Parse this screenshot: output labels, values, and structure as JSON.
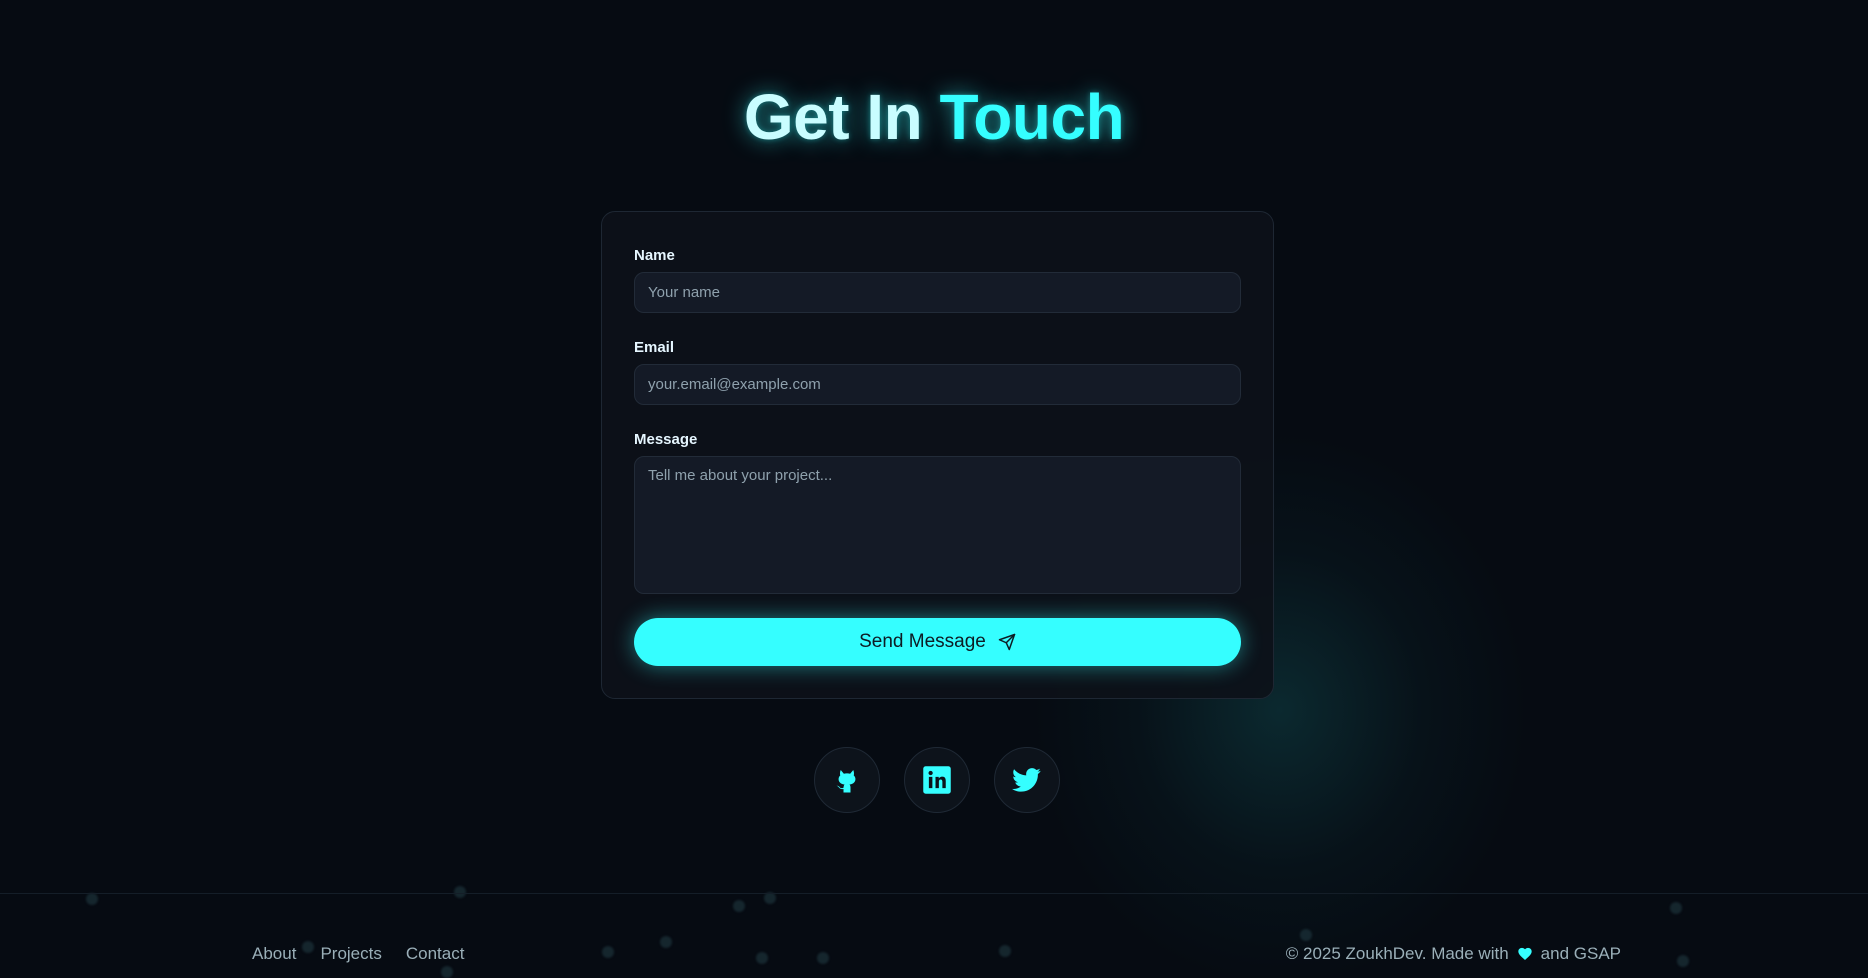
{
  "colors": {
    "accent": "#35feff",
    "background": "#060b12",
    "card": "#0d1119"
  },
  "header": {
    "title_part1": "Get In",
    "title_part2": "Touch"
  },
  "form": {
    "name_label": "Name",
    "name_placeholder": "Your name",
    "email_label": "Email",
    "email_placeholder": "your.email@example.com",
    "message_label": "Message",
    "message_placeholder": "Tell me about your project...",
    "submit_label": "Send Message",
    "submit_icon": "paper-plane-icon"
  },
  "social": [
    {
      "icon": "github-icon"
    },
    {
      "icon": "linkedin-icon"
    },
    {
      "icon": "twitter-icon"
    }
  ],
  "footer": {
    "links": [
      "About",
      "Projects",
      "Contact"
    ],
    "copyright_prefix": "© 2025 ZoukhDev. Made with",
    "copyright_icon": "heart-icon",
    "copyright_suffix": "and GSAP"
  }
}
